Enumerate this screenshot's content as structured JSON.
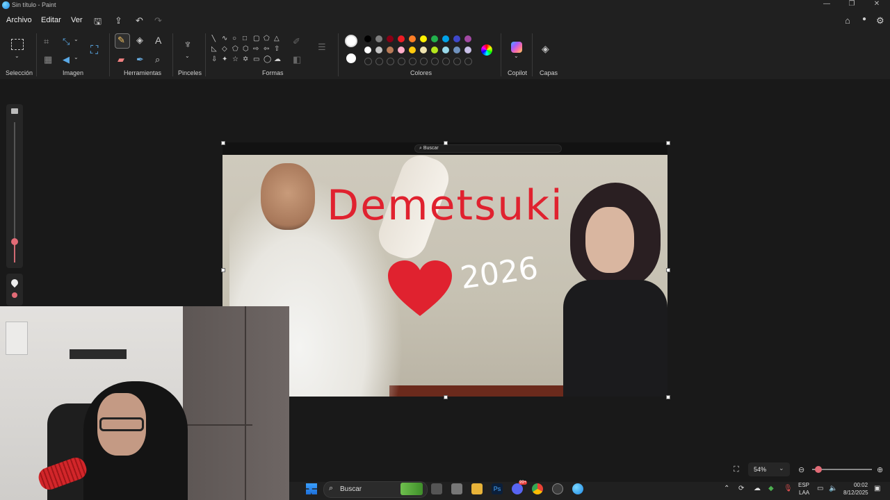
{
  "window": {
    "title": "Sin título - Paint",
    "controls": [
      "minimize-icon",
      "restore-icon",
      "close-icon"
    ]
  },
  "menu": {
    "items": [
      "Archivo",
      "Editar",
      "Ver"
    ],
    "quick_icons": [
      "save-icon",
      "share-icon",
      "undo-icon",
      "redo-icon"
    ],
    "right_icons": [
      "feedback-icon",
      "account-icon",
      "settings-icon"
    ]
  },
  "ribbon": {
    "groups": {
      "seleccion": "Selección",
      "imagen": "Imagen",
      "herramientas": "Herramientas",
      "pinceles": "Pinceles",
      "formas": "Formas",
      "colores": "Colores",
      "copilot": "Copilot",
      "capas": "Capas"
    },
    "active_tool": "pencil",
    "primary_color": "#ffffff",
    "secondary_color": "#ffffff",
    "palette_row1": [
      "#000000",
      "#7f7f7f",
      "#880015",
      "#ed1c24",
      "#ff7f27",
      "#fff200",
      "#22b14c",
      "#00a2e8",
      "#3f48cc",
      "#a349a4"
    ],
    "palette_row2": [
      "#ffffff",
      "#c3c3c3",
      "#b97a57",
      "#ffaec9",
      "#ffc90e",
      "#efe4b0",
      "#b5e61d",
      "#99d9ea",
      "#7092be",
      "#c8bfe7"
    ]
  },
  "canvas": {
    "search_text": "Buscar",
    "drawn_text": "Demetsuki",
    "drawn_year": "2026",
    "ink_color": "#e0222f"
  },
  "status": {
    "zoom": "54%"
  },
  "taskbar": {
    "search_label": "Buscar",
    "apps": [
      "file-manager-icon",
      "printer-icon",
      "folder-icon",
      "photoshop-icon",
      "discord-icon",
      "chrome-icon",
      "steam-icon",
      "paint-icon"
    ],
    "photoshop_label": "Ps",
    "discord_badge": "99+",
    "lang_top": "ESP",
    "lang_bottom": "LAA",
    "time": "00:02",
    "date": "8/12/2025"
  }
}
